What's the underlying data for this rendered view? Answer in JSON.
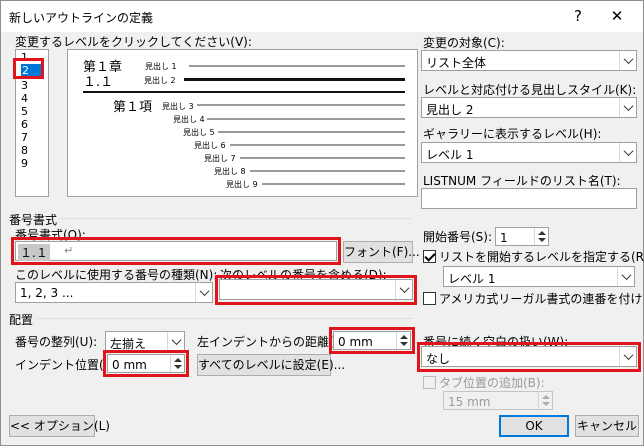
{
  "window": {
    "title": "新しいアウトラインの定義",
    "help_label": "?",
    "close_label": "✕"
  },
  "levels": {
    "label": "変更するレベルをクリックしてください(V):",
    "items": [
      "1",
      "2",
      "3",
      "4",
      "5",
      "6",
      "7",
      "8",
      "9"
    ],
    "selected": "2"
  },
  "preview": {
    "chapter": "第１章",
    "section": "１.１",
    "item": "第１項",
    "heading_prefix": "見出し",
    "rows": [
      {
        "text": "見出し 1"
      },
      {
        "text": "見出し 2"
      },
      {
        "text": "見出し 3"
      },
      {
        "text": "見出し 4"
      },
      {
        "text": "見出し 5"
      },
      {
        "text": "見出し 6"
      },
      {
        "text": "見出し 7"
      },
      {
        "text": "見出し 8"
      },
      {
        "text": "見出し 9"
      }
    ]
  },
  "right_panel": {
    "target_label": "変更の対象(C):",
    "target_value": "リスト全体",
    "style_label": "レベルと対応付ける見出しスタイル(K):",
    "style_value": "見出し 2",
    "gallery_label": "ギャラリーに表示するレベル(H):",
    "gallery_value": "レベル 1",
    "listnum_label": "LISTNUM フィールドのリスト名(T):",
    "listnum_value": ""
  },
  "number_format": {
    "group_label": "番号書式",
    "format_label": "番号書式(O):",
    "format_value": "１.１",
    "return_mark": "↵",
    "font_button": "フォント(F)...",
    "kind_label": "このレベルに使用する番号の種類(N):",
    "kind_value": "1, 2, 3 ...",
    "include_label": "次のレベルの番号を含める(D):",
    "include_value": "",
    "start_label": "開始番号(S):",
    "start_value": "1",
    "restart_label": "リストを開始するレベルを指定する(R):",
    "restart_checked": true,
    "restart_value": "レベル 1",
    "legal_label": "アメリカ式リーガル書式の連番を付ける(G)",
    "legal_checked": false
  },
  "position": {
    "group_label": "配置",
    "align_label": "番号の整列(U):",
    "align_value": "左揃え",
    "left_indent_label": "左インデントからの距離(A):",
    "left_indent_value": "0 mm",
    "indent_label": "インデント位置(I):",
    "indent_value": "0 mm",
    "apply_all_button": "すべてのレベルに設定(E)...",
    "follow_label": "番号に続く空白の扱い(W):",
    "follow_value": "なし",
    "tab_add_label": "タブ位置の追加(B):",
    "tab_add_checked": false,
    "tab_value": "15 mm"
  },
  "footer": {
    "options_button": "<< オプション(L)",
    "ok_button": "OK",
    "cancel_button": "キャンセル"
  },
  "colors": {
    "highlight": "#e0141c",
    "selection": "#0078d7"
  }
}
